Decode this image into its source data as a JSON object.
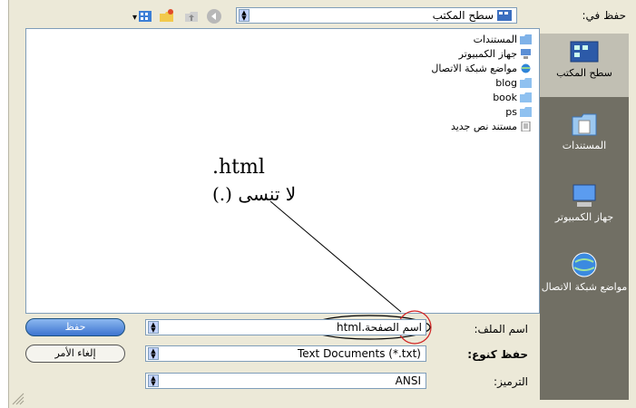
{
  "save_in": {
    "label": "حفظ في:",
    "value": "سطح المكتب"
  },
  "toolbar": {
    "icons": [
      "back-icon",
      "up-folder-icon",
      "new-folder-icon",
      "views-menu-icon"
    ]
  },
  "places": [
    {
      "label": "سطح المكتب",
      "icon": "desktop-icon",
      "selected": true
    },
    {
      "label": "المستندات",
      "icon": "documents-icon"
    },
    {
      "label": "جهاز الكمبيوتر",
      "icon": "computer-icon"
    },
    {
      "label": "مواضع شبكة الاتصال",
      "icon": "network-icon"
    }
  ],
  "files": [
    {
      "name": "المستندات",
      "icon": "documents-folder-icon"
    },
    {
      "name": "جهاز الكمبيوتر",
      "icon": "computer-icon"
    },
    {
      "name": "مواضع شبكة الاتصال",
      "icon": "network-icon"
    },
    {
      "name": "blog",
      "icon": "folder-icon"
    },
    {
      "name": "book",
      "icon": "folder-icon"
    },
    {
      "name": "ps",
      "icon": "folder-icon"
    },
    {
      "name": "مستند نص جديد",
      "icon": "text-file-icon"
    }
  ],
  "annotation": {
    "line1": ".html",
    "line2": "لا تنسى (.)"
  },
  "file_name": {
    "label": "اسم الملف:",
    "value": "اسم الصفحة.html"
  },
  "save_as_type": {
    "label": "حفظ كنوع:",
    "value": "Text Documents (*.txt)"
  },
  "encoding": {
    "label": "الترميز:",
    "value": "ANSI"
  },
  "buttons": {
    "save": "حفظ",
    "cancel": "إلغاء الأمر"
  },
  "colors": {
    "dialog_bg": "#ece9d8",
    "places_bg": "#716f64",
    "highlight_red": "#d12020"
  }
}
